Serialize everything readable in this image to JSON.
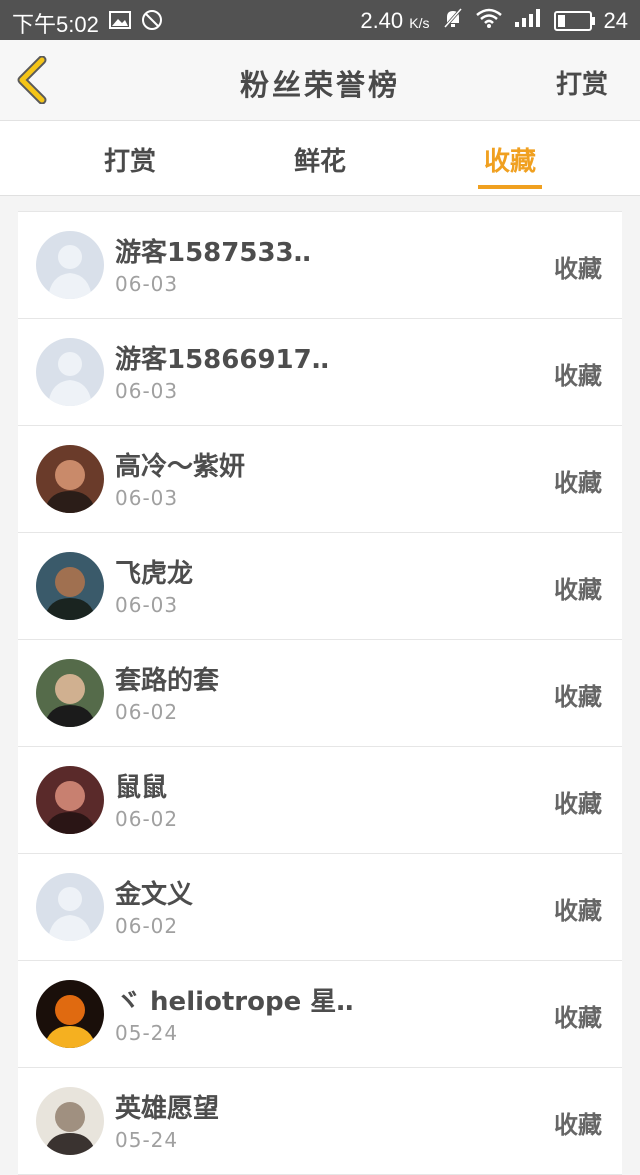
{
  "status_bar": {
    "time": "下午5:02",
    "speed": "2.40",
    "speed_unit": "K/s",
    "battery": "24",
    "battery_level": 0.24
  },
  "header": {
    "title": "粉丝荣誉榜",
    "right_label": "打赏"
  },
  "tabs": [
    {
      "label": "打赏",
      "active": false
    },
    {
      "label": "鲜花",
      "active": false
    },
    {
      "label": "收藏",
      "active": true
    }
  ],
  "colors": {
    "accent": "#f0a020",
    "statusbar": "#525252"
  },
  "list": [
    {
      "name": "游客1587533‥",
      "date": "06-03",
      "action": "收藏",
      "avatar": "default-avatar-icon"
    },
    {
      "name": "游客15866917‥",
      "date": "06-03",
      "action": "收藏",
      "avatar": "default-avatar-icon"
    },
    {
      "name": "高冷～紫妍",
      "date": "06-03",
      "action": "收藏",
      "avatar": "user-photo-avatar"
    },
    {
      "name": "飞虎龙",
      "date": "06-03",
      "action": "收藏",
      "avatar": "user-photo-avatar"
    },
    {
      "name": "套路的套",
      "date": "06-02",
      "action": "收藏",
      "avatar": "user-photo-avatar"
    },
    {
      "name": "鼠鼠",
      "date": "06-02",
      "action": "收藏",
      "avatar": "user-photo-avatar"
    },
    {
      "name": "金文义",
      "date": "06-02",
      "action": "收藏",
      "avatar": "default-avatar-icon"
    },
    {
      "name": "ヾ heliotrope 星‥",
      "date": "05-24",
      "action": "收藏",
      "avatar": "user-photo-avatar"
    },
    {
      "name": "英雄愿望",
      "date": "05-24",
      "action": "收藏",
      "avatar": "user-photo-avatar"
    }
  ]
}
